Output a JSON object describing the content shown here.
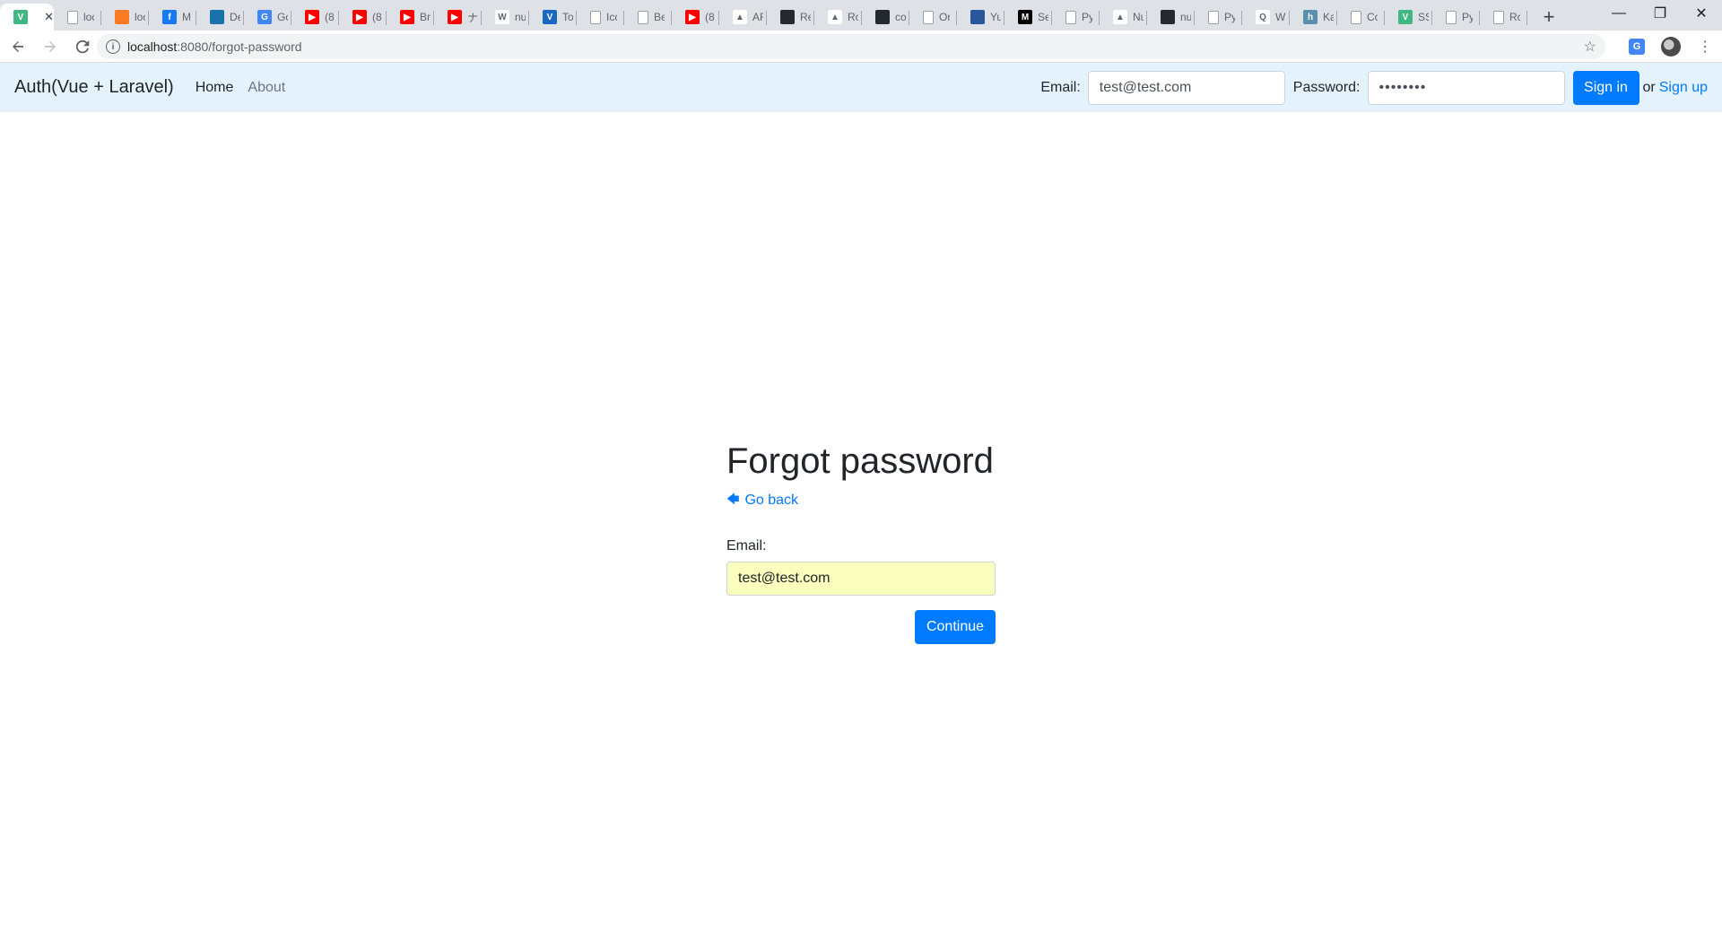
{
  "browser": {
    "tabs": [
      {
        "icon": "vue-icon",
        "glyph": "V",
        "color": "#41b883",
        "title": ""
      },
      {
        "icon": "page-icon",
        "glyph": "",
        "color": "#ffffff",
        "title": "loc"
      },
      {
        "icon": "xampp-icon",
        "glyph": "",
        "color": "#fb7a24",
        "title": "loc"
      },
      {
        "icon": "facebook-icon",
        "glyph": "f",
        "color": "#1877f2",
        "title": "M"
      },
      {
        "icon": "devtools-icon",
        "glyph": "",
        "color": "#1a73a8",
        "title": "De"
      },
      {
        "icon": "google-translate-icon",
        "glyph": "G",
        "color": "#4285f4",
        "title": "Gc"
      },
      {
        "icon": "youtube-icon",
        "glyph": "▶",
        "color": "#ff0000",
        "title": "(8"
      },
      {
        "icon": "youtube-icon",
        "glyph": "▶",
        "color": "#ff0000",
        "title": "(8"
      },
      {
        "icon": "youtube-icon",
        "glyph": "▶",
        "color": "#ff0000",
        "title": "Br"
      },
      {
        "icon": "youtube-icon",
        "glyph": "▶",
        "color": "#ff0000",
        "title": "ナ"
      },
      {
        "icon": "wikipedia-icon",
        "glyph": "W",
        "color": "#ffffff",
        "title": "nu"
      },
      {
        "icon": "vuetify-icon",
        "glyph": "V",
        "color": "#1867c0",
        "title": "To"
      },
      {
        "icon": "circle-icon",
        "glyph": "",
        "color": "#ffffff",
        "title": "Icc"
      },
      {
        "icon": "page-icon",
        "glyph": "",
        "color": "#ffffff",
        "title": "Be"
      },
      {
        "icon": "youtube-icon",
        "glyph": "▶",
        "color": "#ff0000",
        "title": "(8"
      },
      {
        "icon": "nuxt-icon",
        "glyph": "▲",
        "color": "#ffffff",
        "title": "AF"
      },
      {
        "icon": "github-icon",
        "glyph": "",
        "color": "#24292e",
        "title": "Re"
      },
      {
        "icon": "nuxt-icon",
        "glyph": "▲",
        "color": "#ffffff",
        "title": "Ro"
      },
      {
        "icon": "github-icon",
        "glyph": "",
        "color": "#24292e",
        "title": "co"
      },
      {
        "icon": "code-icon",
        "glyph": "",
        "color": "#ffffff",
        "title": "Or"
      },
      {
        "icon": "stackoverflow-icon",
        "glyph": "",
        "color": "#2b579a",
        "title": "Yu"
      },
      {
        "icon": "medium-icon",
        "glyph": "M",
        "color": "#000000",
        "title": "Se"
      },
      {
        "icon": "page-icon",
        "glyph": "",
        "color": "#ffffff",
        "title": "Py"
      },
      {
        "icon": "nuxt-icon",
        "glyph": "▲",
        "color": "#ffffff",
        "title": "Nu"
      },
      {
        "icon": "github-icon",
        "glyph": "",
        "color": "#24292e",
        "title": "nu"
      },
      {
        "icon": "page-icon",
        "glyph": "",
        "color": "#ffffff",
        "title": "Py"
      },
      {
        "icon": "quora-icon",
        "glyph": "Q",
        "color": "#ffffff",
        "title": "W"
      },
      {
        "icon": "hashnode-icon",
        "glyph": "h",
        "color": "#5a8fae",
        "title": "Ka"
      },
      {
        "icon": "chrome-icon",
        "glyph": "",
        "color": "#ffffff",
        "title": "Cc"
      },
      {
        "icon": "vue-icon",
        "glyph": "V",
        "color": "#41b883",
        "title": "SS"
      },
      {
        "icon": "page-icon",
        "glyph": "",
        "color": "#ffffff",
        "title": "Py"
      },
      {
        "icon": "send-icon",
        "glyph": "",
        "color": "#ffffff",
        "title": "Rc"
      }
    ],
    "url_host": "localhost",
    "url_path": ":8080/forgot-password"
  },
  "navbar": {
    "brand": "Auth(Vue + Laravel)",
    "home": "Home",
    "about": "About",
    "email_label": "Email:",
    "email_value": "test@test.com",
    "password_label": "Password:",
    "password_value": "••••••••",
    "signin": "Sign in",
    "or": "or",
    "signup": "Sign up"
  },
  "page": {
    "title": "Forgot password",
    "go_back": "Go back",
    "email_label": "Email:",
    "email_value": "test@test.com",
    "continue": "Continue"
  },
  "colors": {
    "navbar_bg": "#e3f2fd",
    "primary": "#007bff",
    "autofill_bg": "#faffbd"
  }
}
